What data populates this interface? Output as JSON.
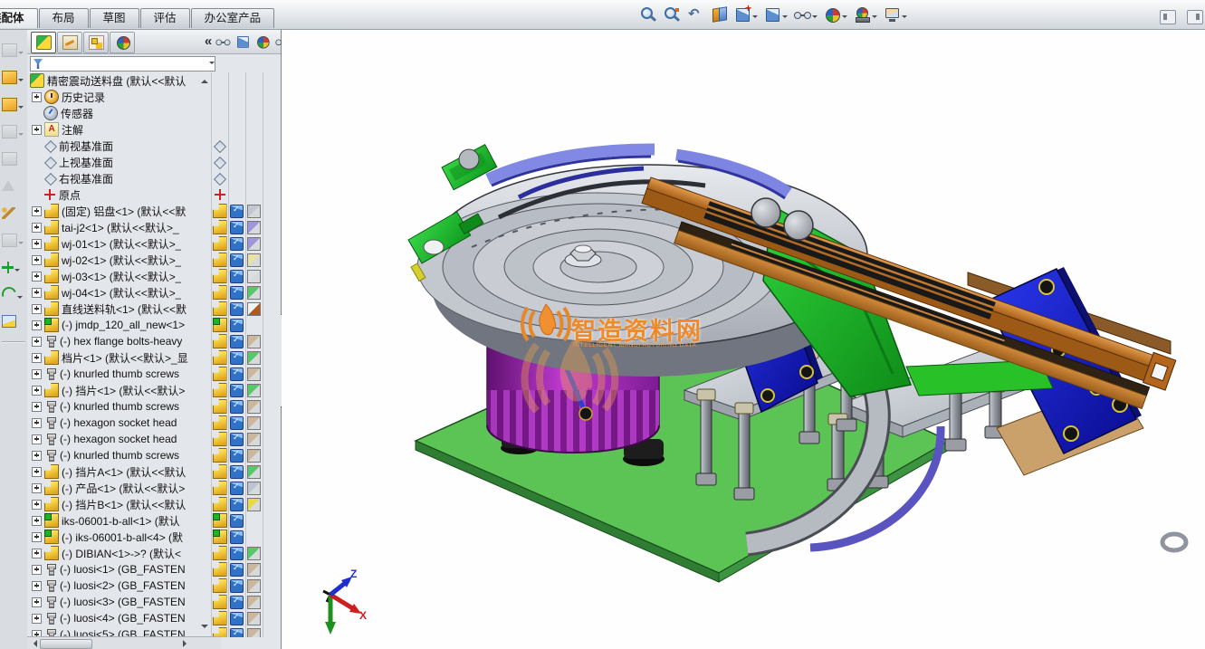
{
  "command_tabs": {
    "items": [
      {
        "id": "assembly",
        "label": "装配体",
        "active": true
      },
      {
        "id": "layout",
        "label": "布局",
        "active": false
      },
      {
        "id": "sketch",
        "label": "草图",
        "active": false
      },
      {
        "id": "evaluate",
        "label": "评估",
        "active": false
      },
      {
        "id": "office-products",
        "label": "办公室产品",
        "active": false
      }
    ]
  },
  "view_toolbar": {
    "icons": [
      {
        "name": "zoom-to-fit-icon",
        "glyph": "icon-mag",
        "dropdown": false
      },
      {
        "name": "zoom-to-area-icon",
        "glyph": "icon-mag zoom-to-area-icon",
        "dropdown": false
      },
      {
        "name": "previous-view-icon",
        "glyph": "previous-view-icon",
        "dropdown": false
      },
      {
        "name": "section-view-icon",
        "glyph": "section-view-icon",
        "dropdown": false
      },
      {
        "name": "view-orientation-icon",
        "glyph": "icon-cube view-orientation-icon",
        "dropdown": true
      },
      {
        "name": "display-style-icon",
        "glyph": "icon-cube",
        "dropdown": true
      },
      {
        "name": "hide-show-items-icon",
        "glyph": "icon-glasses",
        "dropdown": true
      },
      {
        "name": "edit-appearance-icon",
        "glyph": "icon-ball",
        "dropdown": true
      },
      {
        "name": "apply-scene-icon",
        "glyph": "icon-ball apply-scene-icon",
        "dropdown": true
      },
      {
        "name": "view-settings-icon",
        "glyph": "view-settings-icon",
        "dropdown": true
      }
    ]
  },
  "pane_toggles": {
    "icons": [
      {
        "name": "left-pane-toggle-icon",
        "side": "l"
      },
      {
        "name": "right-pane-toggle-icon",
        "side": "r"
      }
    ]
  },
  "left_toolbar": {
    "buttons": [
      {
        "name": "edit-component-button",
        "kind": "grey-box",
        "dropdown": true,
        "disabled": true
      },
      {
        "name": "insert-components-button",
        "kind": "orange-box",
        "dropdown": true,
        "disabled": false
      },
      {
        "name": "mate-button",
        "kind": "orange-box",
        "dropdown": true,
        "disabled": false
      },
      {
        "name": "linear-component-pattern-button",
        "kind": "grey-box",
        "dropdown": true,
        "disabled": true
      },
      {
        "name": "smart-fasteners-button",
        "kind": "grey-box",
        "dropdown": false,
        "disabled": true
      },
      {
        "name": "move-component-button",
        "kind": "grey-tri",
        "dropdown": false,
        "disabled": true
      },
      {
        "name": "show-hidden-components-button",
        "kind": "wand",
        "dropdown": false,
        "disabled": false
      },
      {
        "name": "assembly-features-button",
        "kind": "grey-box",
        "dropdown": true,
        "disabled": true
      },
      {
        "name": "reference-geometry-button",
        "kind": "green-star",
        "dropdown": true,
        "disabled": false
      },
      {
        "name": "new-motion-study-button",
        "kind": "green-curve",
        "dropdown": true,
        "disabled": false
      },
      {
        "name": "exploded-view-button",
        "kind": "blue-doc",
        "dropdown": false,
        "disabled": false
      }
    ]
  },
  "feature_panel": {
    "collapse_label": "«",
    "tabs": [
      {
        "id": "featuremanager",
        "icon": "featuremanager-tree-icon",
        "active": true
      },
      {
        "id": "propertymanager",
        "icon": "propertymanager-icon",
        "active": false
      },
      {
        "id": "configurationmanager",
        "icon": "configurationmanager-icon",
        "active": false
      },
      {
        "id": "displaymanager",
        "icon": "displaymanager-icon",
        "active": false
      }
    ],
    "display_pane_header": [
      {
        "name": "hide-show-column-icon",
        "glyph": "icon-glasses"
      },
      {
        "name": "display-mode-column-icon",
        "glyph": "icon-cube"
      },
      {
        "name": "appearance-column-icon",
        "glyph": "icon-ball"
      },
      {
        "name": "transparency-column-icon",
        "glyph": "icon-glasses"
      }
    ],
    "tree": {
      "items": [
        {
          "label": "精密震动送料盘 (默认<<默认",
          "icon": "assembly",
          "plus": false,
          "pane": null
        },
        {
          "label": "历史记录",
          "icon": "history",
          "plus": true,
          "pane": null
        },
        {
          "label": "传感器",
          "icon": "sensor",
          "plus": false,
          "pane": null
        },
        {
          "label": "注解",
          "icon": "annotation",
          "plus": true,
          "pane": null
        },
        {
          "label": "前视基准面",
          "icon": "plane",
          "plus": false,
          "pane": {
            "c1": "plane"
          }
        },
        {
          "label": "上视基准面",
          "icon": "plane",
          "plus": false,
          "pane": {
            "c1": "plane"
          }
        },
        {
          "label": "右视基准面",
          "icon": "plane",
          "plus": false,
          "pane": {
            "c1": "plane"
          }
        },
        {
          "label": "原点",
          "icon": "origin",
          "plus": false,
          "pane": {
            "c1": "origin"
          }
        },
        {
          "label": "(固定) 铝盘<1> (默认<<默",
          "icon": "part",
          "plus": true,
          "pane": {
            "c1": "part",
            "cube": true,
            "swatch": "#c2c6cf"
          }
        },
        {
          "label": "tai-j2<1> (默认<<默认>_",
          "icon": "part",
          "plus": true,
          "pane": {
            "c1": "part",
            "cube": true,
            "swatch": "#9f95dc"
          }
        },
        {
          "label": "wj-01<1> (默认<<默认>_",
          "icon": "part",
          "plus": true,
          "pane": {
            "c1": "part",
            "cube": true,
            "swatch": "#9f95dc"
          }
        },
        {
          "label": "wj-02<1> (默认<<默认>_",
          "icon": "part",
          "plus": true,
          "pane": {
            "c1": "part",
            "cube": true,
            "swatch": "#e9e2a4"
          }
        },
        {
          "label": "wj-03<1> (默认<<默认>_",
          "icon": "part",
          "plus": true,
          "pane": {
            "c1": "part",
            "cube": true,
            "swatch": "#dcdfe3"
          }
        },
        {
          "label": "wj-04<1> (默认<<默认>_",
          "icon": "part",
          "plus": true,
          "pane": {
            "c1": "part",
            "cube": true,
            "swatch": "#57c96a"
          }
        },
        {
          "label": "直线送料轨<1> (默认<<默",
          "icon": "part",
          "plus": true,
          "pane": {
            "c1": "part",
            "cube": true,
            "swatch": "#f2f3f5",
            "swatch2": "#b05a1e"
          }
        },
        {
          "label": "(-) jmdp_120_all_new<1>",
          "icon": "subassembly",
          "plus": true,
          "pane": {
            "c1": "subassembly",
            "cube": true
          }
        },
        {
          "label": "(-) hex flange bolts-heavy",
          "icon": "screw",
          "plus": true,
          "pane": {
            "c1": "part",
            "cube": true,
            "swatch": "#cdb79c"
          }
        },
        {
          "label": "档片<1> (默认<<默认>_显",
          "icon": "part",
          "plus": true,
          "pane": {
            "c1": "part",
            "cube": true,
            "swatch": "#57c96a"
          }
        },
        {
          "label": "(-) knurled thumb screws",
          "icon": "screw",
          "plus": true,
          "pane": {
            "c1": "part",
            "cube": true,
            "swatch": "#cdb79c"
          }
        },
        {
          "label": "(-) 挡片<1> (默认<<默认>",
          "icon": "part",
          "plus": true,
          "pane": {
            "c1": "part",
            "cube": true,
            "swatch": "#57c96a"
          }
        },
        {
          "label": "(-) knurled thumb screws",
          "icon": "screw",
          "plus": true,
          "pane": {
            "c1": "part",
            "cube": true,
            "swatch": "#cdb79c"
          }
        },
        {
          "label": "(-) hexagon socket head",
          "icon": "screw",
          "plus": true,
          "pane": {
            "c1": "part",
            "cube": true,
            "swatch": "#cdb79c"
          }
        },
        {
          "label": "(-) hexagon socket head",
          "icon": "screw",
          "plus": true,
          "pane": {
            "c1": "part",
            "cube": true,
            "swatch": "#cdb79c"
          }
        },
        {
          "label": "(-) knurled thumb screws",
          "icon": "screw",
          "plus": true,
          "pane": {
            "c1": "part",
            "cube": true,
            "swatch": "#cdb79c"
          }
        },
        {
          "label": "(-) 挡片A<1> (默认<<默认",
          "icon": "part",
          "plus": true,
          "pane": {
            "c1": "part",
            "cube": true,
            "swatch": "#57c96a"
          }
        },
        {
          "label": "(-) 产品<1> (默认<<默认>",
          "icon": "part",
          "plus": true,
          "pane": {
            "c1": "part",
            "cube": true,
            "swatch": "#bcc4d0"
          }
        },
        {
          "label": "(-) 挡片B<1> (默认<<默认",
          "icon": "part",
          "plus": true,
          "pane": {
            "c1": "part",
            "cube": true,
            "swatch": "#e8d84a"
          }
        },
        {
          "label": "iks-06001-b-all<1> (默认",
          "icon": "subassembly",
          "plus": true,
          "pane": {
            "c1": "subassembly",
            "cube": true
          }
        },
        {
          "label": "(-) iks-06001-b-all<4> (默",
          "icon": "subassembly",
          "plus": true,
          "pane": {
            "c1": "subassembly",
            "cube": true
          }
        },
        {
          "label": "(-) DIBIAN<1>->? (默认<",
          "icon": "part",
          "plus": true,
          "pane": {
            "c1": "part",
            "cube": true,
            "swatch": "#57c96a"
          }
        },
        {
          "label": "(-) luosi<1> (GB_FASTEN",
          "icon": "screw",
          "plus": true,
          "pane": {
            "c1": "part",
            "cube": true,
            "swatch": "#cdb79c"
          }
        },
        {
          "label": "(-) luosi<2> (GB_FASTEN",
          "icon": "screw",
          "plus": true,
          "pane": {
            "c1": "part",
            "cube": true,
            "swatch": "#cdb79c"
          }
        },
        {
          "label": "(-) luosi<3> (GB_FASTEN",
          "icon": "screw",
          "plus": true,
          "pane": {
            "c1": "part",
            "cube": true,
            "swatch": "#cdb79c"
          }
        },
        {
          "label": "(-) luosi<4> (GB_FASTEN",
          "icon": "screw",
          "plus": true,
          "pane": {
            "c1": "part",
            "cube": true,
            "swatch": "#cdb79c"
          }
        },
        {
          "label": "(-) luosi<5> (GB_FASTEN",
          "icon": "screw",
          "plus": true,
          "pane": {
            "c1": "part",
            "cube": true,
            "swatch": "#cdb79c"
          }
        }
      ]
    }
  },
  "viewport": {
    "watermark": {
      "title": "智造资料网",
      "subtitle": "INTELLIGENT MANUFACTURING DATA",
      "color": "#ee8a2a"
    },
    "triad": {
      "x_label": "X",
      "z_label": "Z"
    },
    "model": {
      "base_plate_color": "#5cc455",
      "bowl_color": "#c6cad1",
      "vibrator_color": "#9c27b0",
      "rail_color": "#c07a33",
      "spring_color": "#1a1ae0",
      "clamp_color": "#17b217"
    }
  }
}
